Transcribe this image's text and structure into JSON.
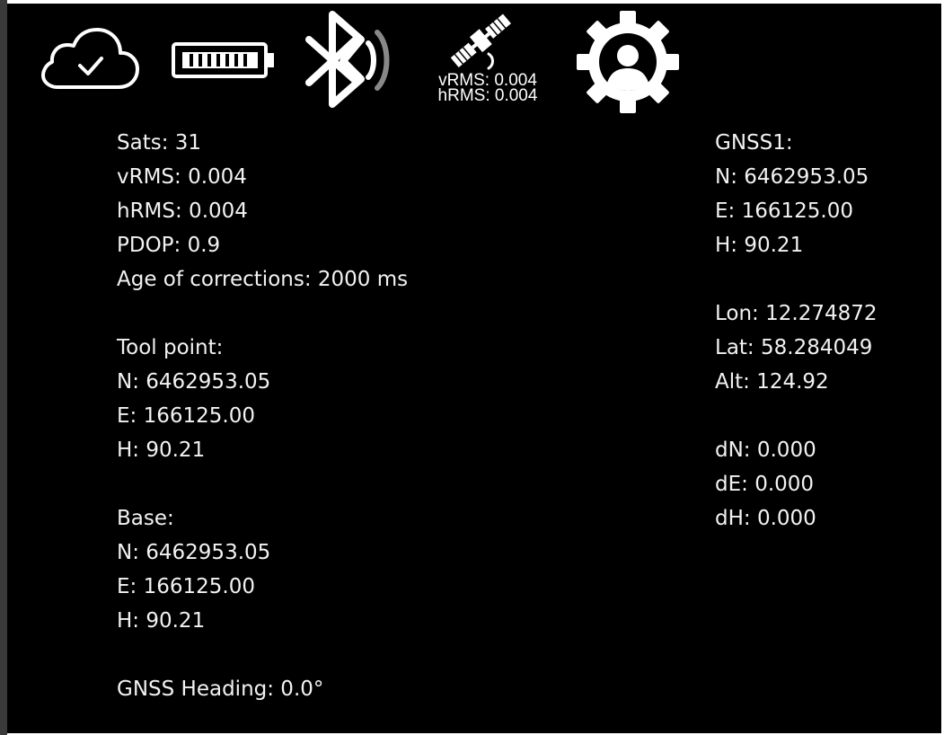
{
  "status_bar": {
    "icons": {
      "cloud": "cloud-check-icon",
      "battery": "battery-full-icon",
      "bluetooth": "bluetooth-connected-icon",
      "satellite": "satellite-icon",
      "settings": "settings-gear-user-icon"
    },
    "satellite_vrms": "vRMS: 0.004",
    "satellite_hrms": "hRMS: 0.004"
  },
  "quality": {
    "sats": "Sats: 31",
    "vrms": "vRMS: 0.004",
    "hrms": "hRMS: 0.004",
    "pdop": "PDOP: 0.9",
    "age_of_corrections": "Age of corrections: 2000 ms"
  },
  "tool_point": {
    "label": "Tool point:",
    "n": "N: 6462953.05",
    "e": "E: 166125.00",
    "h": "H: 90.21"
  },
  "base": {
    "label": "Base:",
    "n": "N: 6462953.05",
    "e": "E: 166125.00",
    "h": "H: 90.21"
  },
  "gnss_heading": "GNSS Heading: 0.0°",
  "gnss1": {
    "label": "GNSS1:",
    "n": "N: 6462953.05",
    "e": "E: 166125.00",
    "h": "H: 90.21"
  },
  "geographic": {
    "lon": "Lon: 12.274872",
    "lat": "Lat: 58.284049",
    "alt": "Alt: 124.92"
  },
  "deltas": {
    "dn": "dN: 0.000",
    "de": "dE: 0.000",
    "dh": "dH: 0.000"
  },
  "colors": {
    "background": "#000000",
    "text": "#f2f2f2",
    "frame": "#3a3a3a"
  }
}
